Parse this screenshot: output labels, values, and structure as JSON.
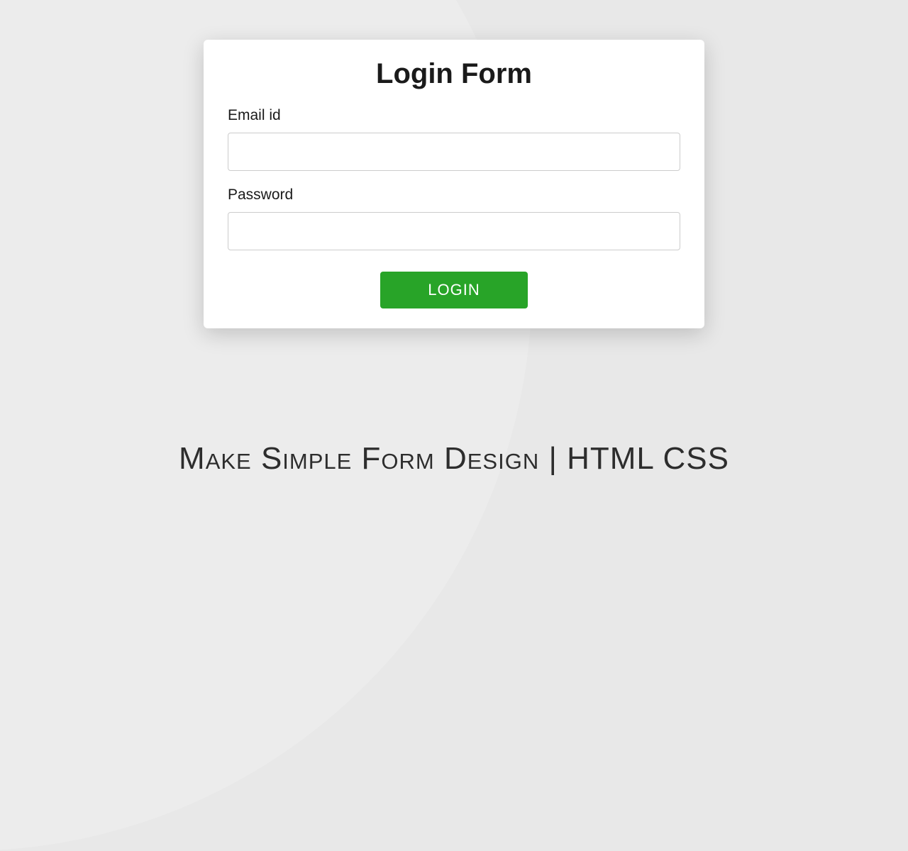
{
  "form": {
    "title": "Login Form",
    "email_label": "Email id",
    "email_value": "",
    "password_label": "Password",
    "password_value": "",
    "submit_label": "LOGIN"
  },
  "caption": "Make Simple Form Design | HTML CSS",
  "colors": {
    "button_bg": "#28a428",
    "page_bg": "#e8e8e8"
  }
}
